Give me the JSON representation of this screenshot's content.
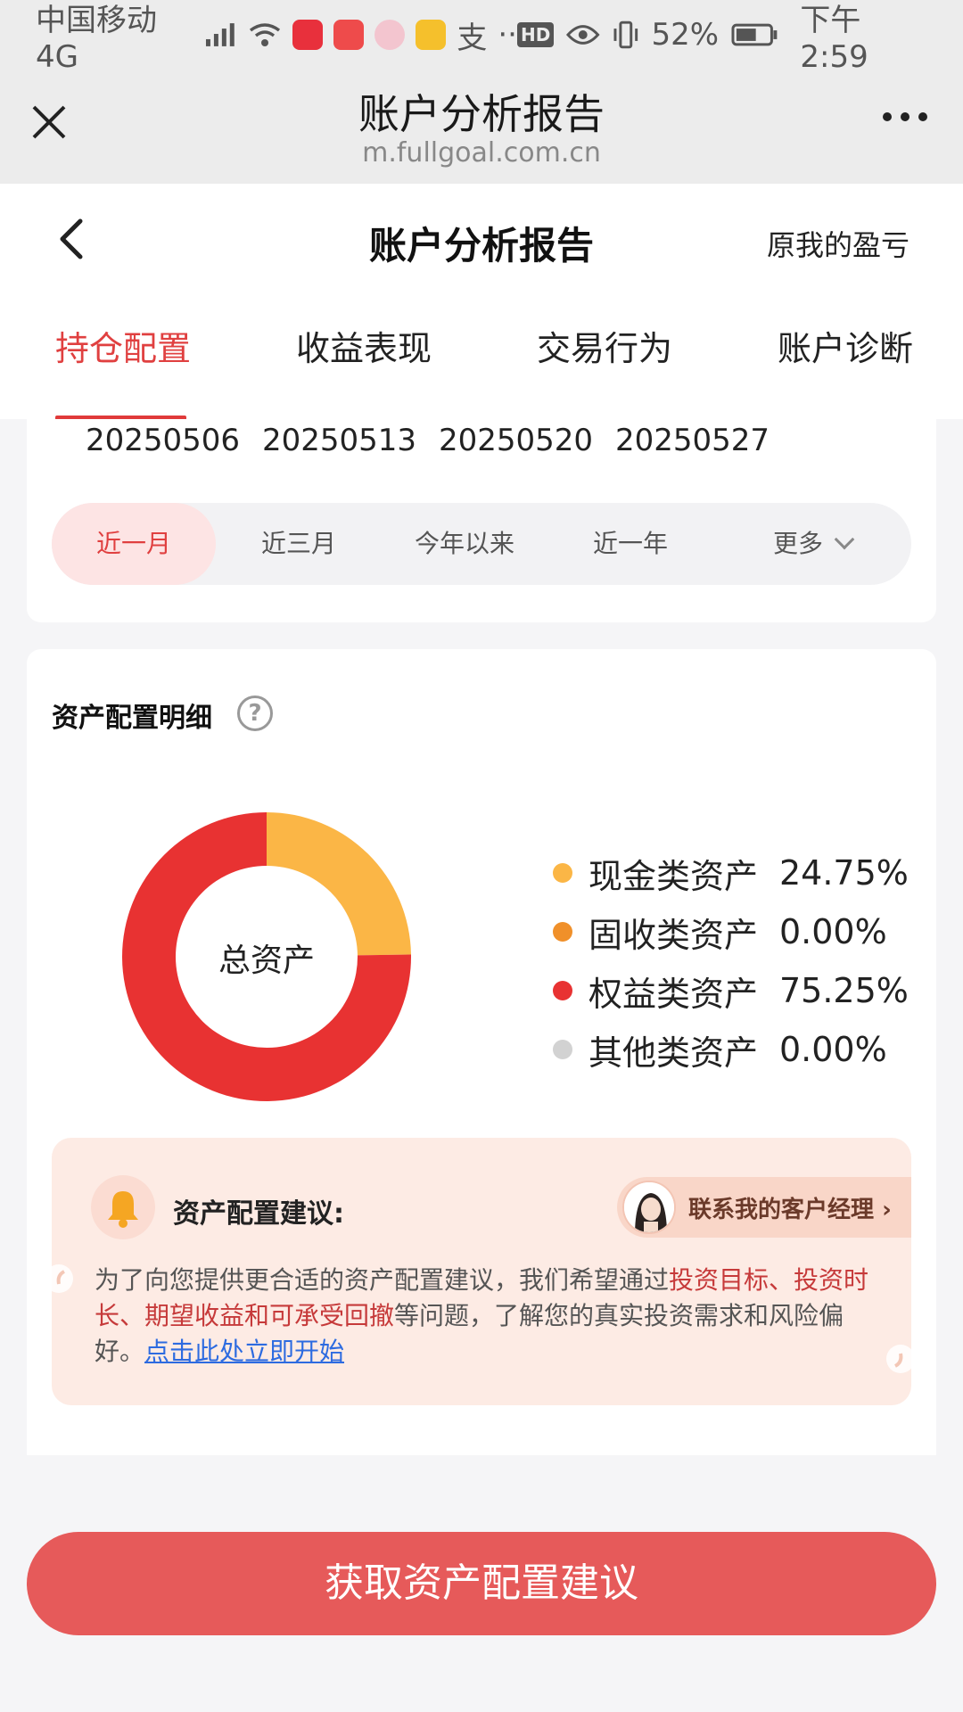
{
  "status_bar": {
    "carrier": "中国移动4G",
    "network_badge": "4G",
    "battery": "52%",
    "time": "下午2:59",
    "app_badges": [
      "小红书",
      "HUAWEI"
    ]
  },
  "browser": {
    "title": "账户分析报告",
    "url": "m.fullgoal.com.cn"
  },
  "page": {
    "title": "账户分析报告",
    "right_link": "原我的盈亏"
  },
  "tabs": [
    {
      "label": "持仓配置",
      "active": true
    },
    {
      "label": "收益表现",
      "active": false
    },
    {
      "label": "交易行为",
      "active": false
    },
    {
      "label": "账户诊断",
      "active": false
    }
  ],
  "dates": [
    "20250506",
    "20250513",
    "20250520",
    "20250527"
  ],
  "periods": [
    {
      "label": "近一月",
      "active": true
    },
    {
      "label": "近三月",
      "active": false
    },
    {
      "label": "今年以来",
      "active": false
    },
    {
      "label": "近一年",
      "active": false
    },
    {
      "label": "更多",
      "active": false
    }
  ],
  "allocation": {
    "title": "资产配置明细",
    "help_symbol": "?",
    "center_label": "总资产",
    "items": [
      {
        "name": "现金类资产",
        "value": "24.75%",
        "color": "#fbb646"
      },
      {
        "name": "固收类资产",
        "value": "0.00%",
        "color": "#f0902a"
      },
      {
        "name": "权益类资产",
        "value": "75.25%",
        "color": "#e83232"
      },
      {
        "name": "其他类资产",
        "value": "0.00%",
        "color": "#d2d2d2"
      }
    ]
  },
  "chart_data": {
    "type": "pie",
    "categories": [
      "现金类资产",
      "固收类资产",
      "权益类资产",
      "其他类资产"
    ],
    "values": [
      24.75,
      0.0,
      75.25,
      0.0
    ],
    "colors": [
      "#fbb646",
      "#f0902a",
      "#e83232",
      "#d2d2d2"
    ],
    "title": "资产配置明细",
    "center_label": "总资产"
  },
  "advice": {
    "title": "资产配置建议:",
    "manager_label": "联系我的客户经理",
    "text_part1": "为了向您提供更合适的资产配置建议，我们希望通过",
    "highlight": "投资目标、投资时长、期望收益和可承受回撤",
    "text_part2": "等问题，了解您的真实投资需求和风险偏好。",
    "link": "点击此处立即开始"
  },
  "cta": {
    "label": "获取资产配置建议"
  },
  "colors": {
    "accent": "#e04040",
    "cta_bg": "#e65a5a",
    "advice_bg": "#fdebe4",
    "link": "#2d6be0"
  }
}
